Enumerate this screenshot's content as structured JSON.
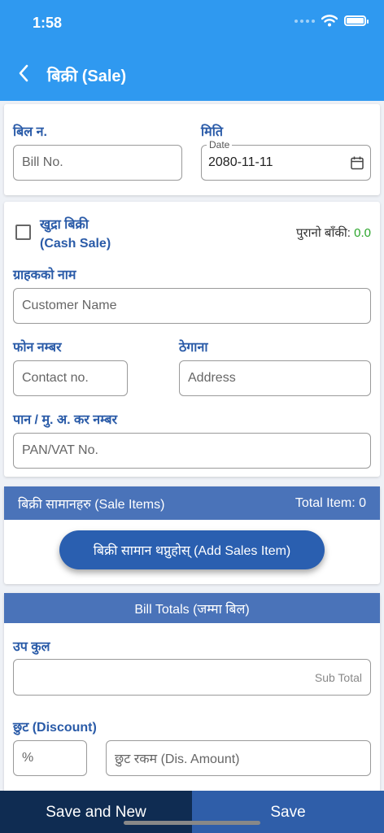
{
  "status": {
    "time": "1:58"
  },
  "header": {
    "title": "बिक्री (Sale)"
  },
  "bill": {
    "bill_no_label": "बिल न.",
    "bill_no_placeholder": "Bill No.",
    "date_label": "मिति",
    "date_float_label": "Date",
    "date_value": "2080-11-11"
  },
  "customer": {
    "cash_sale_line1": "खुद्रा बिक्री",
    "cash_sale_line2": "(Cash Sale)",
    "cash_sale_checked": false,
    "old_balance_label": "पुरानो बाँकी:",
    "old_balance_value": "0.0",
    "name_label": "ग्राहकको नाम",
    "name_placeholder": "Customer Name",
    "phone_label": "फोन नम्बर",
    "phone_placeholder": "Contact no.",
    "address_label": "ठेगाना",
    "address_placeholder": "Address",
    "pan_label": "पान / मु. अ. कर नम्बर",
    "pan_placeholder": "PAN/VAT No."
  },
  "sale_items": {
    "title": "बिक्री सामानहरु (Sale Items)",
    "total_label": "Total Item: 0",
    "add_button": "बिक्री सामान थप्नुहोस्  (Add Sales Item)"
  },
  "totals": {
    "title": "Bill Totals (जम्मा बिल)",
    "subtotal_label": "उप कुल",
    "subtotal_placeholder": "Sub Total",
    "discount_label": "छुट (Discount)",
    "discount_percent_placeholder": "%",
    "discount_amount_placeholder": "छुट रकम (Dis. Amount)"
  },
  "actions": {
    "save_and_new": "Save and New",
    "save": "Save"
  },
  "colors": {
    "header": "#2f99f0",
    "label": "#2a5ba8",
    "section": "#4a73b9",
    "balance": "#2aa52a"
  }
}
